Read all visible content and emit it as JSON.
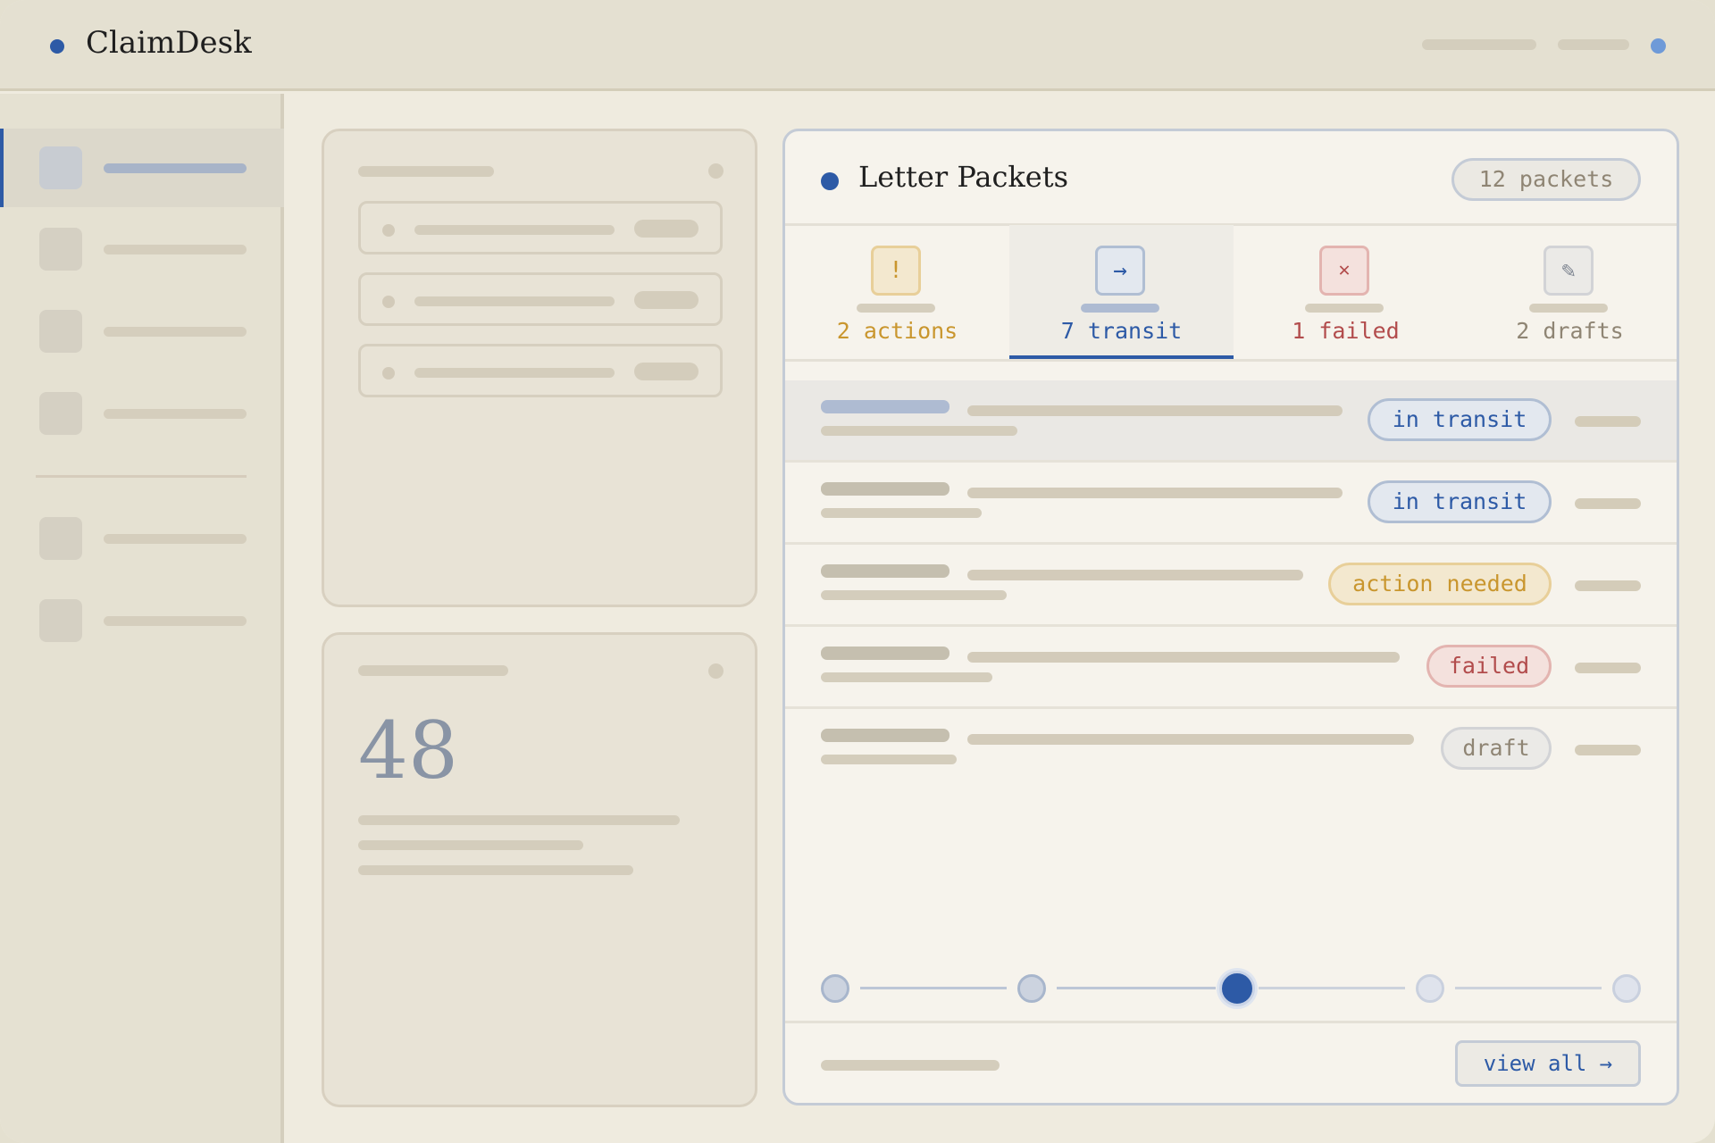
{
  "app": {
    "name": "ClaimDesk"
  },
  "colors": {
    "accent": "#2d5aa6",
    "warning": "#c9962e",
    "danger": "#b24c4c",
    "neutral": "#8f8574"
  },
  "stats_card": {
    "value": "48"
  },
  "panel": {
    "title": "Letter Packets",
    "count_label": "12 packets",
    "tabs": [
      {
        "label": "2 actions",
        "icon": "exclamation-icon",
        "glyph": "!",
        "active": false
      },
      {
        "label": "7 transit",
        "icon": "arrow-right-icon",
        "glyph": "→",
        "active": true
      },
      {
        "label": "1 failed",
        "icon": "close-x-icon",
        "glyph": "✕",
        "active": false
      },
      {
        "label": "2 drafts",
        "icon": "pencil-icon",
        "glyph": "✎",
        "active": false
      }
    ],
    "rows": [
      {
        "status": "in transit"
      },
      {
        "status": "in transit"
      },
      {
        "status": "action needed"
      },
      {
        "status": "failed"
      },
      {
        "status": "draft"
      }
    ],
    "steps": {
      "count": 5,
      "current": 3
    },
    "view_all_label": "view all →"
  }
}
